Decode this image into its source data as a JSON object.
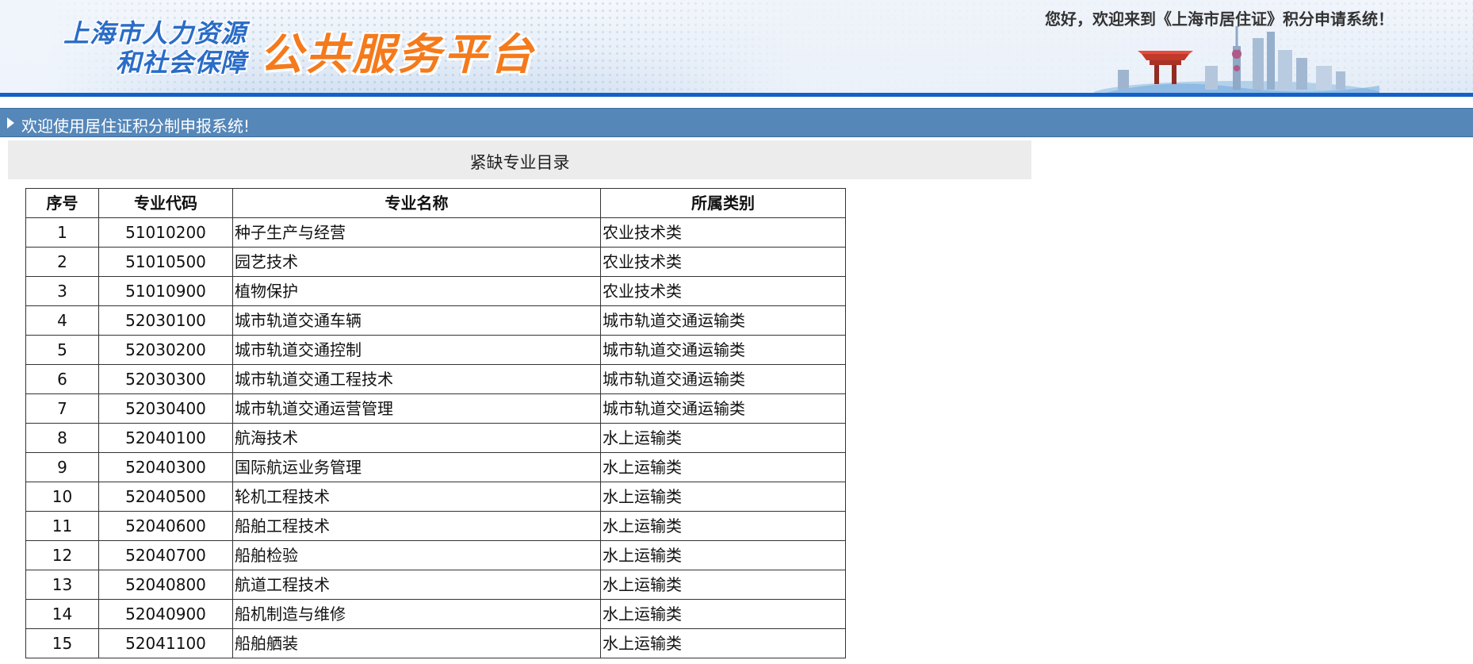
{
  "banner": {
    "logo_line1": "上海市人力资源",
    "logo_line2": "和社会保障",
    "platform_title": "公共服务平台",
    "welcome": "您好，欢迎来到《上海市居住证》积分申请系统！"
  },
  "nav": {
    "welcome_text": "欢迎使用居住证积分制申报系统!"
  },
  "section": {
    "title": "紧缺专业目录"
  },
  "table": {
    "headers": [
      "序号",
      "专业代码",
      "专业名称",
      "所属类别"
    ],
    "rows": [
      [
        "1",
        "51010200",
        "种子生产与经营",
        "农业技术类"
      ],
      [
        "2",
        "51010500",
        "园艺技术",
        "农业技术类"
      ],
      [
        "3",
        "51010900",
        "植物保护",
        "农业技术类"
      ],
      [
        "4",
        "52030100",
        "城市轨道交通车辆",
        "城市轨道交通运输类"
      ],
      [
        "5",
        "52030200",
        "城市轨道交通控制",
        "城市轨道交通运输类"
      ],
      [
        "6",
        "52030300",
        "城市轨道交通工程技术",
        "城市轨道交通运输类"
      ],
      [
        "7",
        "52030400",
        "城市轨道交通运营管理",
        "城市轨道交通运输类"
      ],
      [
        "8",
        "52040100",
        "航海技术",
        "水上运输类"
      ],
      [
        "9",
        "52040300",
        "国际航运业务管理",
        "水上运输类"
      ],
      [
        "10",
        "52040500",
        "轮机工程技术",
        "水上运输类"
      ],
      [
        "11",
        "52040600",
        "船舶工程技术",
        "水上运输类"
      ],
      [
        "12",
        "52040700",
        "船舶检验",
        "水上运输类"
      ],
      [
        "13",
        "52040800",
        "航道工程技术",
        "水上运输类"
      ],
      [
        "14",
        "52040900",
        "船机制造与维修",
        "水上运输类"
      ],
      [
        "15",
        "52041100",
        "船舶舾装",
        "水上运输类"
      ]
    ]
  },
  "colors": {
    "banner_bar": "#1360c8",
    "nav_bg": "#5587b9",
    "logo_blue": "#2a6cc7",
    "title_orange": "#f47a1c",
    "section_bg": "#ececec"
  }
}
